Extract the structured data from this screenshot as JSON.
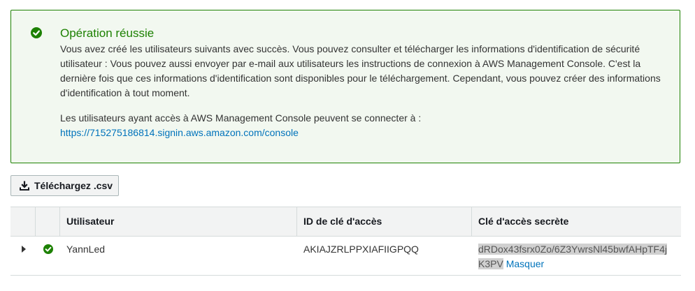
{
  "alert": {
    "title": "Opération réussie",
    "body": "Vous avez créé les utilisateurs suivants avec succès. Vous pouvez consulter et télécharger les informations d'identification de sécurité utilisateur : Vous pouvez aussi envoyer par e-mail aux utilisateurs les instructions de connexion à AWS Management Console. C'est la dernière fois que ces informations d'identification sont disponibles pour le téléchargement. Cependant, vous pouvez créer des informations d'identification à tout moment.",
    "login_text": "Les utilisateurs ayant accès à AWS Management Console peuvent se connecter à :",
    "login_url": "https://715275186814.signin.aws.amazon.com/console",
    "icon": "check-circle-icon",
    "color": "#1d8102"
  },
  "download_button": {
    "label": "Téléchargez .csv",
    "icon": "download-icon"
  },
  "table": {
    "columns": [
      "Utilisateur",
      "ID de clé d'accès",
      "Clé d'accès secrète"
    ],
    "rows": [
      {
        "user": "YannLed",
        "access_key_id": "AKIAJZRLPPXIAFIIGPQQ",
        "secret_key": "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",
        "hide_label": "Masquer",
        "status_icon": "check-circle-icon"
      }
    ]
  },
  "colors": {
    "success": "#1d8102",
    "link": "#0073bb",
    "header_bg": "#f2f3f3"
  }
}
